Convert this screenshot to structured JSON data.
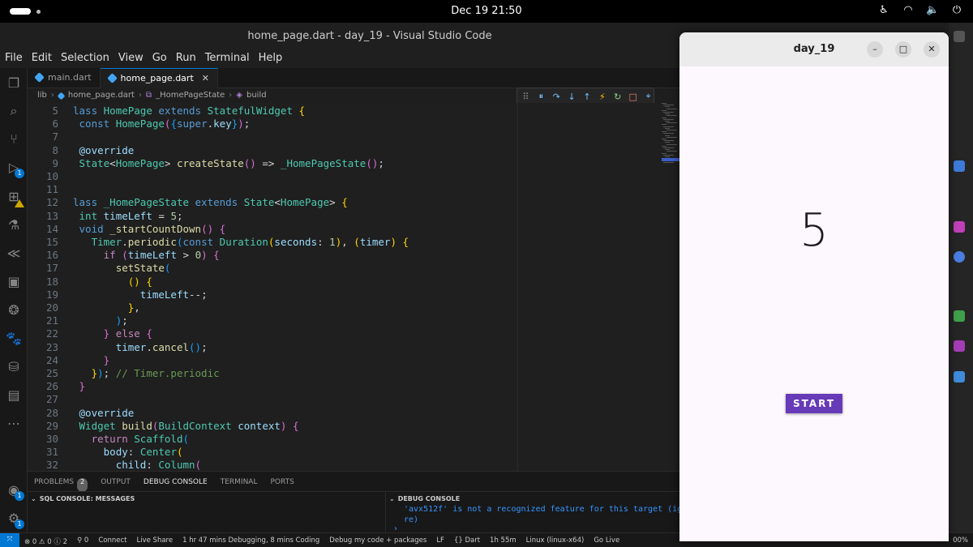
{
  "system": {
    "clock": "Dec 19  21:50"
  },
  "window_title": "home_page.dart - day_19 - Visual Studio Code",
  "menu": [
    "File",
    "Edit",
    "Selection",
    "View",
    "Go",
    "Run",
    "Terminal",
    "Help"
  ],
  "tabs": [
    {
      "label": "main.dart",
      "active": false
    },
    {
      "label": "home_page.dart",
      "active": true,
      "close": "✕"
    }
  ],
  "breadcrumb": [
    "lib",
    "home_page.dart",
    "_HomePageState",
    "build"
  ],
  "editor": {
    "lines": [
      {
        "n": "5",
        "html": "<span class='kb'>lass</span> <span class='t'>HomePage</span> <span class='kb'>extends</span> <span class='t'>StatefulWidget</span> <span class='b1'>{</span>"
      },
      {
        "n": "6",
        "html": " <span class='kb'>const</span> <span class='t'>HomePage</span><span class='b2'>(</span><span class='b3'>{</span><span class='kb'>super</span>.<span class='v'>key</span><span class='b3'>}</span><span class='b2'>)</span>;"
      },
      {
        "n": "7",
        "html": ""
      },
      {
        "n": "8",
        "html": " <span class='v'>@override</span>"
      },
      {
        "n": "9",
        "html": " <span class='t'>State</span>&lt;<span class='t'>HomePage</span>&gt; <span class='f'>createState</span><span class='b2'>()</span> =&gt; <span class='t'>_HomePageState</span><span class='b2'>()</span>;"
      },
      {
        "n": "10",
        "html": ""
      },
      {
        "n": "11",
        "html": ""
      },
      {
        "n": "12",
        "html": "<span class='kb'>lass</span> <span class='t'>_HomePageState</span> <span class='kb'>extends</span> <span class='t'>State</span>&lt;<span class='t'>HomePage</span>&gt; <span class='b1'>{</span>"
      },
      {
        "n": "13",
        "html": " <span class='t'>int</span> <span class='v'>timeLeft</span> = <span class='n'>5</span>;"
      },
      {
        "n": "14",
        "html": " <span class='kb'>void</span> <span class='f'>_startCountDown</span><span class='b2'>()</span> <span class='b2'>{</span>"
      },
      {
        "n": "15",
        "html": "   <span class='t'>Timer</span>.<span class='f'>periodic</span><span class='b3'>(</span><span class='kb'>const</span> <span class='t'>Duration</span><span class='b1'>(</span><span class='v'>seconds</span>: <span class='n'>1</span><span class='b1'>)</span>, <span class='b1'>(</span><span class='v'>timer</span><span class='b1'>)</span> <span class='b1'>{</span>"
      },
      {
        "n": "16",
        "html": "     <span class='k'>if</span> <span class='b2'>(</span><span class='v'>timeLeft</span> &gt; <span class='n'>0</span><span class='b2'>)</span> <span class='b2'>{</span>"
      },
      {
        "n": "17",
        "html": "       <span class='f'>setState</span><span class='b3'>(</span>"
      },
      {
        "n": "18",
        "html": "         <span class='b1'>()</span> <span class='b1'>{</span>"
      },
      {
        "n": "19",
        "html": "           <span class='v'>timeLeft</span>--;"
      },
      {
        "n": "20",
        "html": "         <span class='b1'>}</span>,"
      },
      {
        "n": "21",
        "html": "       <span class='b3'>)</span>;"
      },
      {
        "n": "22",
        "html": "     <span class='b2'>}</span> <span class='k'>else</span> <span class='b2'>{</span>"
      },
      {
        "n": "23",
        "html": "       <span class='v'>timer</span>.<span class='f'>cancel</span><span class='b3'>()</span>;"
      },
      {
        "n": "24",
        "html": "     <span class='b2'>}</span>"
      },
      {
        "n": "25",
        "html": "   <span class='b1'>}</span><span class='b3'>)</span>; <span class='c'>// Timer.periodic</span>"
      },
      {
        "n": "26",
        "html": " <span class='b2'>}</span>"
      },
      {
        "n": "27",
        "html": ""
      },
      {
        "n": "28",
        "html": " <span class='v'>@override</span>"
      },
      {
        "n": "29",
        "html": " <span class='t'>Widget</span> <span class='f'>build</span><span class='b2'>(</span><span class='t'>BuildContext</span> <span class='v'>context</span><span class='b2'>)</span> <span class='b2'>{</span>"
      },
      {
        "n": "30",
        "html": "   <span class='k'>return</span> <span class='t'>Scaffold</span><span class='b3'>(</span>"
      },
      {
        "n": "31",
        "html": "     <span class='v'>body</span>: <span class='t'>Center</span><span class='b1'>(</span>"
      },
      {
        "n": "32",
        "html": "       <span class='v'>child</span>: <span class='t'>Column</span><span class='b2'>(</span>"
      }
    ]
  },
  "panel": {
    "tabs": [
      {
        "label": "PROBLEMS",
        "count": "2"
      },
      {
        "label": "OUTPUT"
      },
      {
        "label": "DEBUG CONSOLE",
        "active": true
      },
      {
        "label": "TERMINAL"
      },
      {
        "label": "PORTS"
      }
    ],
    "left_title": "SQL CONSOLE: MESSAGES",
    "right_title": "DEBUG CONSOLE",
    "console_text": "'avx512f' is not a recognized feature for this target (ig\nre)",
    "prompt": "›"
  },
  "statusbar": [
    "⊗ 0 ⚠ 0 ⓘ 2",
    "⚲ 0",
    "Connect",
    "Live Share",
    "1 hr 47 mins Debugging, 8 mins Coding",
    "Debug my code + packages",
    "LF",
    "{} Dart",
    "1h 55m",
    "Linux (linux-x64)",
    "Go Live",
    "00%"
  ],
  "flutter_app": {
    "title": "day_19",
    "count": "5",
    "button": "START"
  }
}
